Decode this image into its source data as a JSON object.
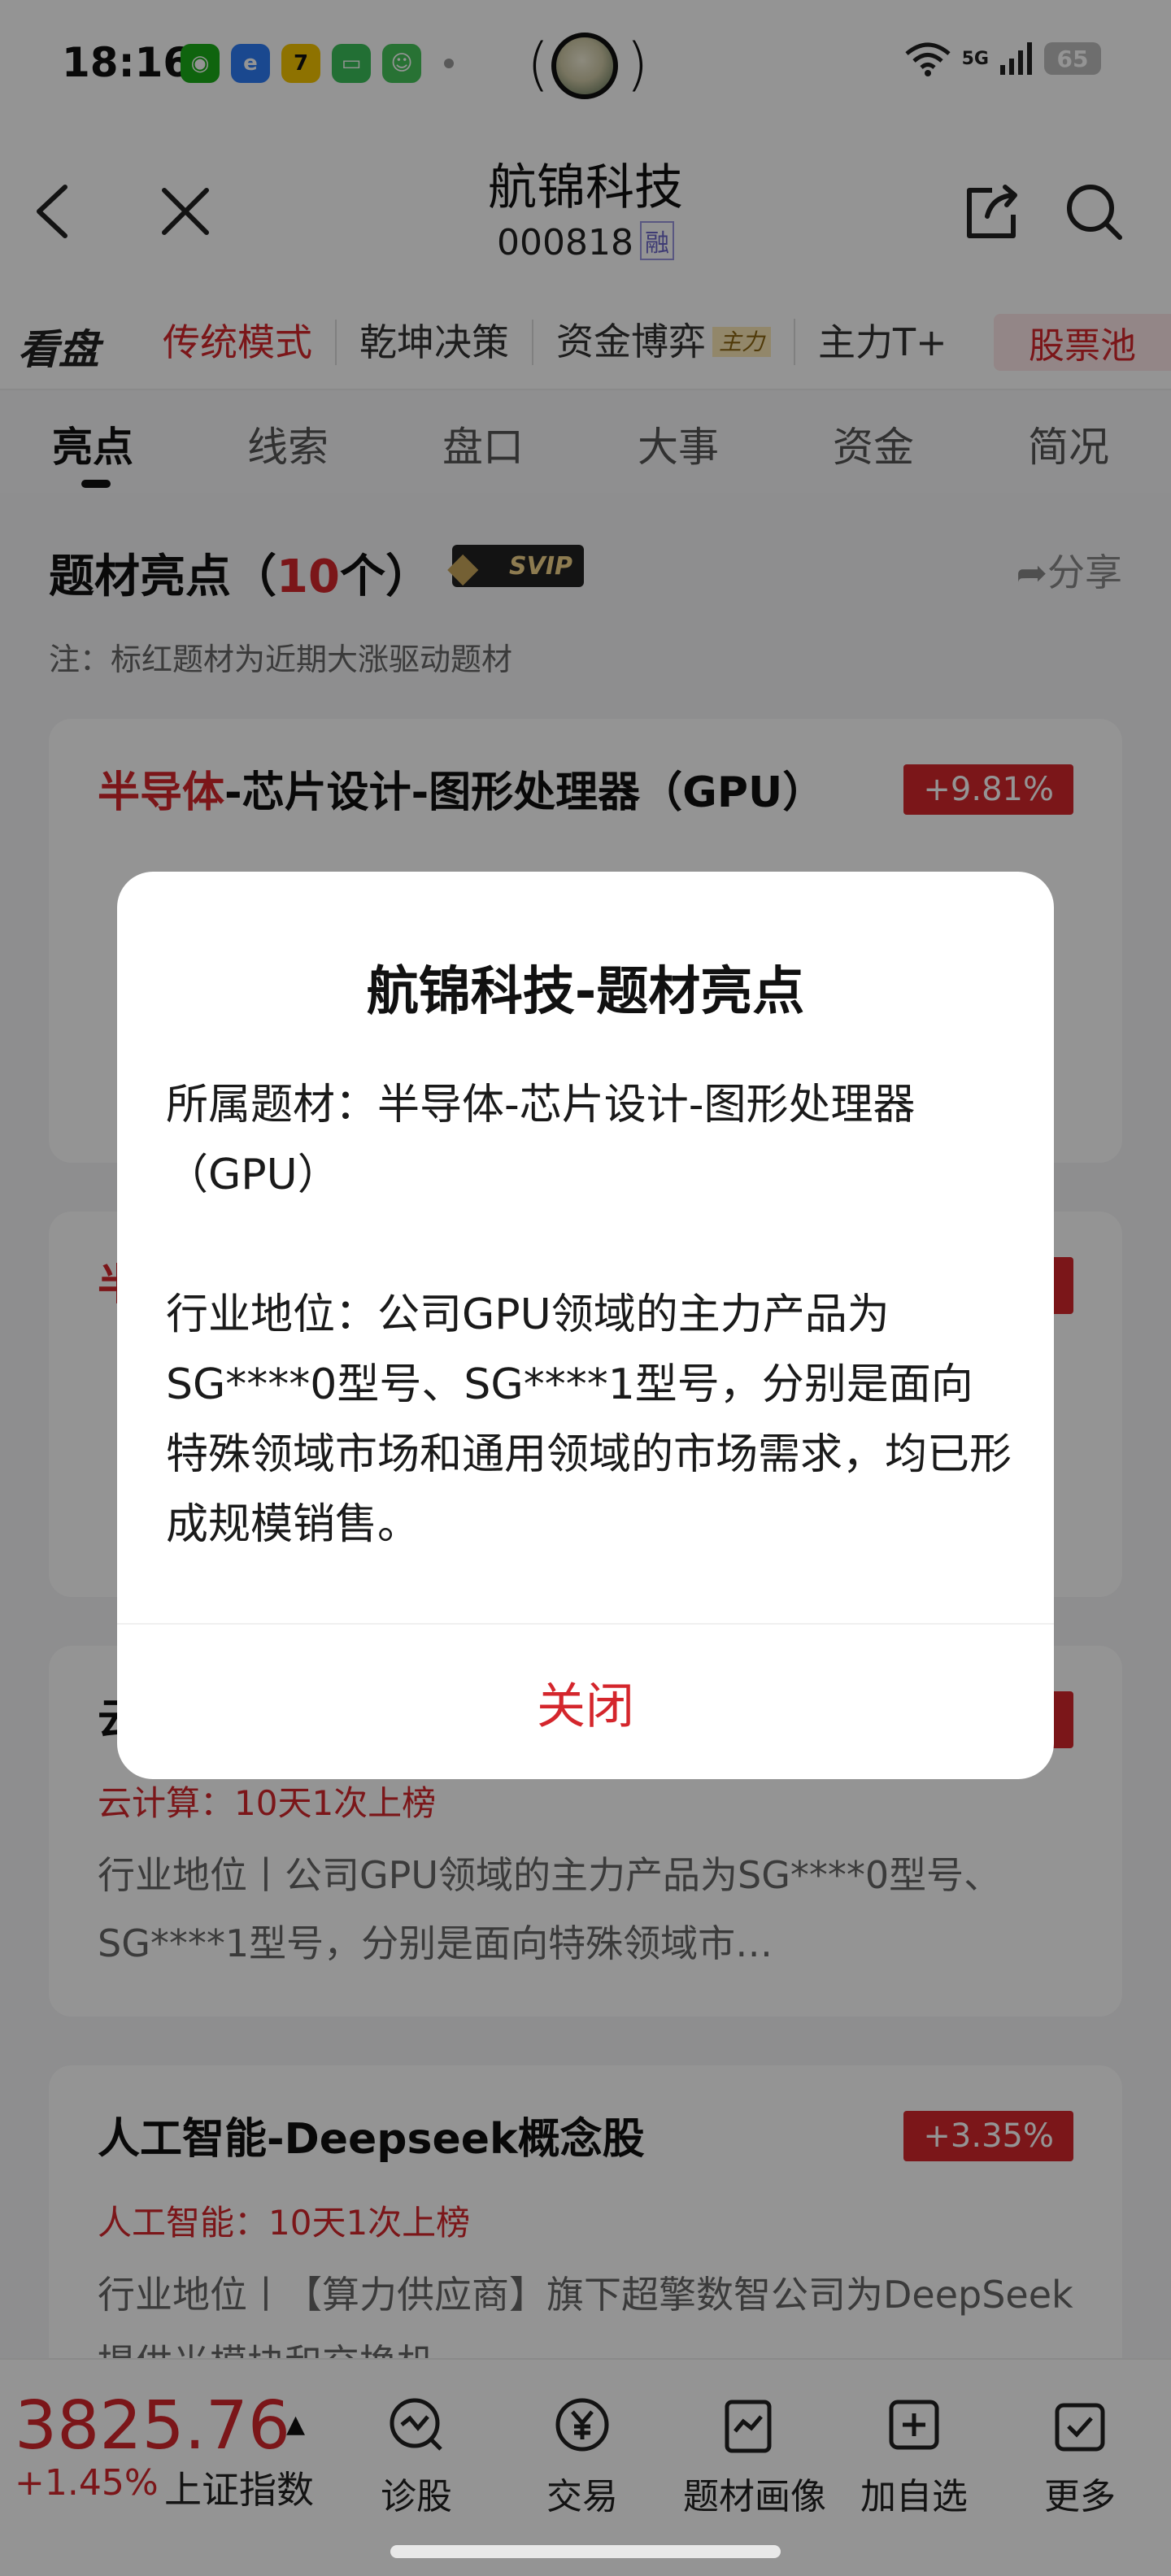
{
  "status": {
    "time": "18:16",
    "network": "5G",
    "battery": "65"
  },
  "header": {
    "title": "航锦科技",
    "code": "000818",
    "badge": "融"
  },
  "modes": {
    "kanpan": "看盘",
    "items": [
      "传统模式",
      "乾坤决策",
      "资金博弈",
      "主力T+"
    ],
    "zhuli_tag": "主力",
    "stock_pool": "股票池"
  },
  "tabs": [
    "亮点",
    "线索",
    "盘口",
    "大事",
    "资金",
    "简况"
  ],
  "section": {
    "title_prefix": "题材亮点（",
    "count": "10",
    "title_suffix": "个）",
    "svip": "SVIP",
    "share": "分享",
    "note": "注：标红题材为近期大涨驱动题材"
  },
  "cards": [
    {
      "title_red": "半导体",
      "title_rest": "-芯片设计-图形处理器（GPU）",
      "pct": "+9.81%"
    },
    {
      "title_red": "半",
      "pct": ""
    },
    {
      "title": "云",
      "sub": "云计算：10天1次上榜",
      "desc": "行业地位丨公司GPU领域的主力产品为SG****0型号、SG****1型号，分别是面向特殊领域市…",
      "pct": ""
    },
    {
      "title": "人工智能-Deepseek概念股",
      "sub": "人工智能：10天1次上榜",
      "desc": "行业地位丨【算力供应商】旗下超擎数智公司为DeepSeek提供光模块和交换机",
      "pct": "+3.35%"
    }
  ],
  "bottom": {
    "index_value": "3825.76",
    "index_change": "+1.45%",
    "index_name": "上证指数",
    "nav": [
      "诊股",
      "交易",
      "题材画像",
      "加自选",
      "更多"
    ]
  },
  "modal": {
    "title": "航锦科技-题材亮点",
    "theme_label": "所属题材：",
    "theme_value": "半导体-芯片设计-图形处理器（GPU）",
    "position_label": "行业地位：",
    "position_value": "公司GPU领域的主力产品为SG****0型号、SG****1型号，分别是面向特殊领域市场和通用领域的市场需求，均已形成规模销售。",
    "close": "关闭"
  },
  "colors": {
    "accent_red": "#d4262c",
    "overlay": "rgba(0,0,0,0.42)"
  }
}
